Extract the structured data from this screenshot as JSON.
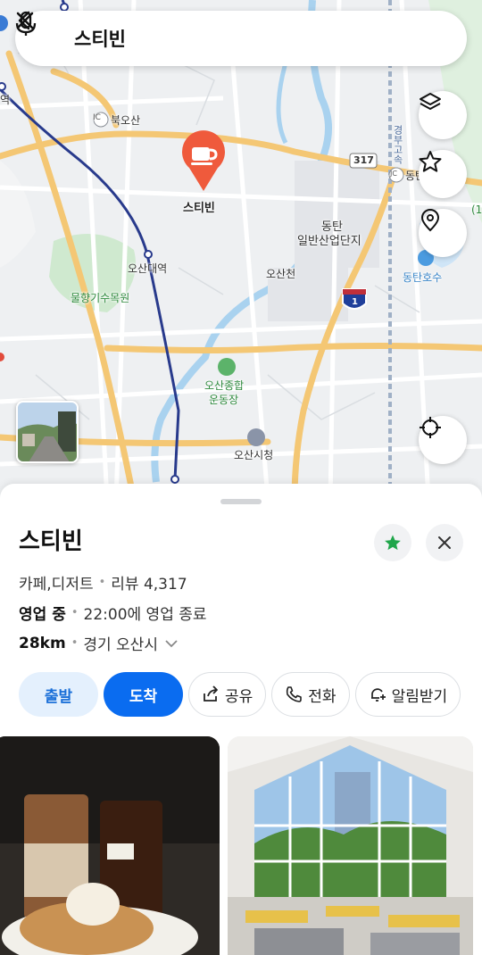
{
  "search": {
    "query": "스티빈",
    "icons": {
      "back": "chevron-left-icon",
      "mic": "microphone-icon",
      "clear": "close-icon"
    }
  },
  "map": {
    "marker_label": "스티빈",
    "labels": {
      "bukosan": "북오산",
      "ic_left": "IC",
      "osan_station": "오산대역",
      "dongtan_1": "동탄",
      "dongtan_2": "일반산업단지",
      "osancheon": "오산천",
      "mulhyang": "물향기수목원",
      "complex_1": "오산종합",
      "complex_2": "운동장",
      "dongtan_lake": "동탄호수",
      "city_hall": "오산시청",
      "route_317": "317",
      "route_1": "1",
      "jc": "JC",
      "dong_right": "동탄",
      "gyeongbu": "경부고속",
      "left_station": "역",
      "right_edge": "(1"
    },
    "side_buttons": [
      "layers-icon",
      "star-icon",
      "location-pin-icon",
      "crosshair-icon"
    ]
  },
  "place": {
    "name": "스티빈",
    "category": "카페,디저트",
    "reviews_label": "리뷰 4,317",
    "status": "영업 중",
    "hours": "22:00에 영업 종료",
    "distance": "28km",
    "region": "경기 오산시",
    "favorite_color": "#1fa64a"
  },
  "actions": {
    "depart": "출발",
    "arrive": "도착",
    "share": "공유",
    "call": "전화",
    "notify": "알림받기"
  },
  "colors": {
    "accent": "#0a6cf0",
    "marker": "#ef5a3c",
    "rail": "#283a8c"
  }
}
